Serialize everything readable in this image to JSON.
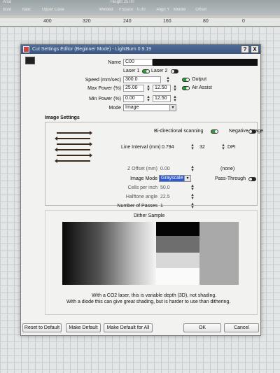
{
  "background": {
    "toolbar_row1": [
      "Arial",
      "Height 25.00"
    ],
    "toolbar_row2": [
      "Bold",
      "Italic",
      "Upper Case",
      "Welded",
      "VSpace",
      "0.00",
      "Align Y",
      "Middle",
      "Offset"
    ],
    "ruler_ticks": [
      "400",
      "320",
      "240",
      "160",
      "80",
      "0"
    ]
  },
  "dialog": {
    "title": "Cut Settings Editor (Beginner Mode) - LightBurn 0.9.19",
    "help_label": "?",
    "close_label": "X",
    "name_label": "Name",
    "name_value": "C00",
    "laser1_label": "Laser 1",
    "laser2_label": "Laser 2",
    "speed_label": "Speed (mm/sec)",
    "speed_value": "300.0",
    "output_label": "Output",
    "maxpower_label": "Max Power (%)",
    "maxpower_value1": "25.00",
    "maxpower_value2": "12.50",
    "airassist_label": "Air Assist",
    "minpower_label": "Min Power (%)",
    "minpower_value1": "0.00",
    "minpower_value2": "12.50",
    "mode_label": "Mode",
    "mode_value": "Image",
    "image_settings": {
      "legend": "Image Settings",
      "bidir_label": "Bi-directional scanning",
      "negative_label": "Negative Image",
      "interval_label": "Line Interval (mm)",
      "interval_value": "0.794",
      "dpi_value": "32",
      "dpi_label": "DPI",
      "zoffset_label": "Z Offset (mm)",
      "zoffset_value": "0.00",
      "zoffset_none": "(none)",
      "imagemode_label": "Image Mode",
      "imagemode_value": "Grayscale",
      "passthrough_label": "Pass-Through",
      "cpi_label": "Cells per inch",
      "cpi_value": "50.0",
      "halftone_label": "Halftone angle",
      "halftone_value": "22.5",
      "passes_label": "Number of Passes",
      "passes_value": "1"
    },
    "dither": {
      "title": "Dither Sample",
      "note1": "With a CO2 laser, this is variable depth (3D), not shading.",
      "note2": "With a diode this can give great shading, but is harder to use than dithering."
    },
    "buttons": {
      "reset": "Reset to Default",
      "make_default": "Make Default",
      "make_default_all": "Make Default for All",
      "ok": "OK",
      "cancel": "Cancel"
    }
  },
  "colors": {
    "title_bar": "#3a5580",
    "toggle_on": "#2f9a3a",
    "selection": "#2f5bd0"
  }
}
